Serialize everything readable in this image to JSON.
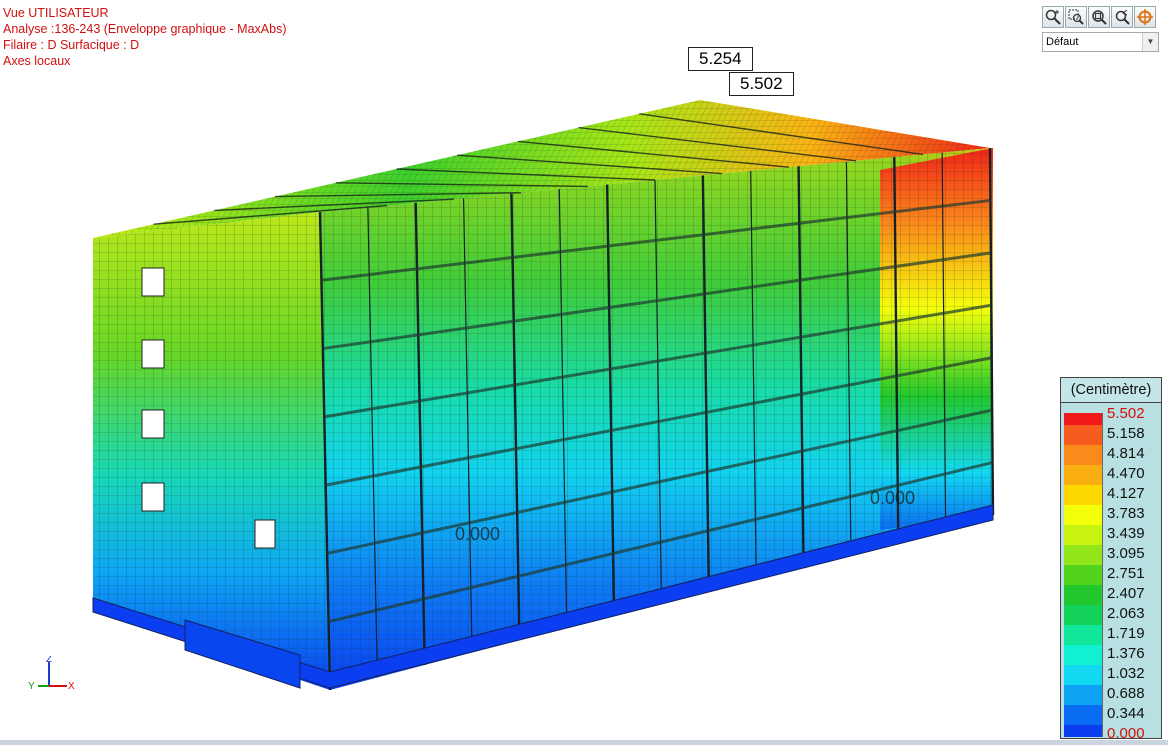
{
  "info": {
    "line1": "Vue UTILISATEUR",
    "line2": "Analyse :136-243 (Enveloppe graphique - MaxAbs)",
    "line3": "Filaire : D Surfacique : D",
    "line4": "Axes locaux"
  },
  "peaks": {
    "label1": "5.254",
    "label2": "5.502"
  },
  "zero_labels": {
    "left": "0.000",
    "right": "0.000"
  },
  "toolbar": {
    "buttons": [
      {
        "name": "zoom-in-icon"
      },
      {
        "name": "zoom-window-icon"
      },
      {
        "name": "zoom-extents-icon"
      },
      {
        "name": "zoom-previous-icon"
      },
      {
        "name": "rotate-view-icon"
      }
    ]
  },
  "view_select": {
    "value": "Défaut"
  },
  "legend": {
    "title": "(Centimètre)",
    "entries": [
      {
        "value": "5.502",
        "color": "#f01818",
        "highlight": true
      },
      {
        "value": "5.158",
        "color": "#f65c1e"
      },
      {
        "value": "4.814",
        "color": "#fa8a1a"
      },
      {
        "value": "4.470",
        "color": "#fbae12"
      },
      {
        "value": "4.127",
        "color": "#ffd800"
      },
      {
        "value": "3.783",
        "color": "#f4ff0a"
      },
      {
        "value": "3.439",
        "color": "#c8f210"
      },
      {
        "value": "3.095",
        "color": "#92e61a"
      },
      {
        "value": "2.751",
        "color": "#52d41c"
      },
      {
        "value": "2.407",
        "color": "#22c82e"
      },
      {
        "value": "2.063",
        "color": "#12d25a"
      },
      {
        "value": "1.719",
        "color": "#12e69a"
      },
      {
        "value": "1.376",
        "color": "#12f0d2"
      },
      {
        "value": "1.032",
        "color": "#12d8f2"
      },
      {
        "value": "0.688",
        "color": "#0ea2f4"
      },
      {
        "value": "0.344",
        "color": "#0a6cf2"
      },
      {
        "value": "0.000",
        "color": "#0a3ef0",
        "highlight": true
      }
    ]
  },
  "axes_triad": {
    "z": "Z",
    "y": "Y",
    "x": "X"
  }
}
